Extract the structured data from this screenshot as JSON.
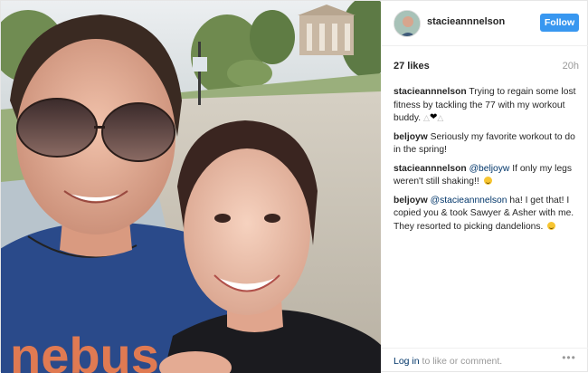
{
  "post": {
    "author": "stacieannnelson",
    "follow_label": "Follow",
    "likes": "27 likes",
    "time": "20h"
  },
  "comments": [
    {
      "user": "stacieannnelson",
      "mention": "",
      "text": "Trying to regain some lost fitness by tackling the 77 with my workout buddy."
    },
    {
      "user": "beljoyw",
      "mention": "",
      "text": "Seriously my favorite workout to do in the spring!"
    },
    {
      "user": "stacieannnelson",
      "mention": "@beljoyw",
      "text": "If only my legs weren't still shaking!!"
    },
    {
      "user": "beljoyw",
      "mention": "@stacieannnelson",
      "text": "ha! I get that! I copied you & took Sawyer & Asher with me. They resorted to picking dandelions."
    }
  ],
  "footer": {
    "login_link": "Log in",
    "login_rest": "to like or comment.",
    "more_icon": "more-horizontal-icon"
  },
  "photo": {
    "shirt_text": "nebus",
    "colors": {
      "sky": "#d9dde0",
      "grass": "#8fa772",
      "path": "#c9c2b4",
      "shirt_left": "#2a4a8a",
      "shirt_right": "#1b1b1f",
      "hair": "#3a2a22",
      "skin": "#e2a88f"
    }
  },
  "colors": {
    "follow_bg": "#3897f0",
    "link": "#003569",
    "muted": "#999999"
  }
}
